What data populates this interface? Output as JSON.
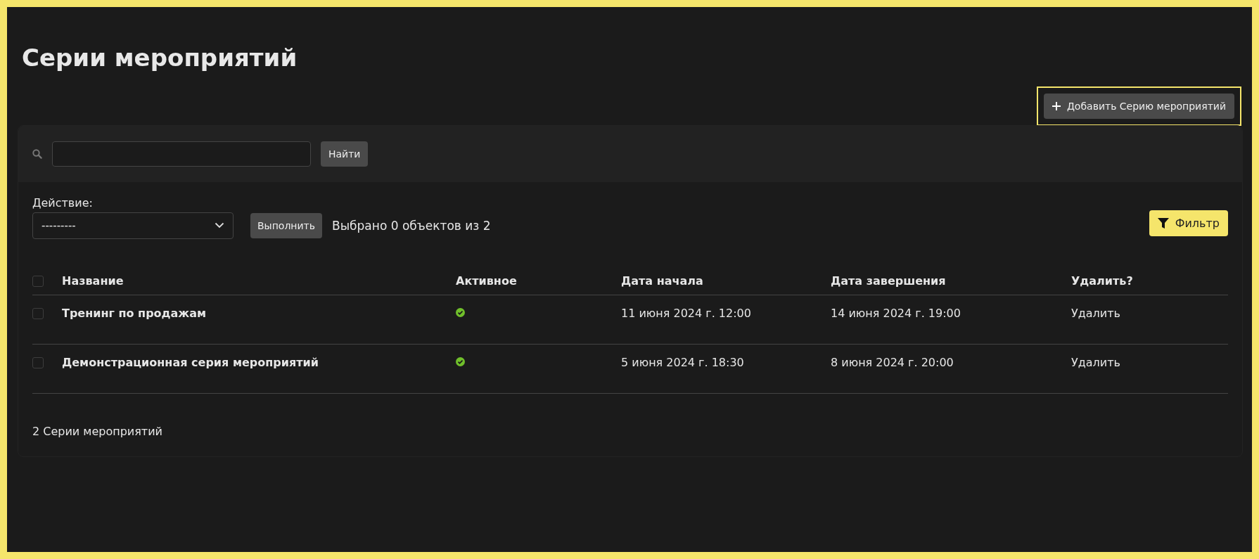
{
  "page": {
    "title": "Серии мероприятий",
    "add_button": "Добавить Серию мероприятий"
  },
  "search": {
    "button": "Найти"
  },
  "actions": {
    "label": "Действие:",
    "select_value": "---------",
    "run_button": "Выполнить",
    "selection_count": "Выбрано 0 объектов из 2",
    "filter_button": "Фильтр"
  },
  "table": {
    "select_all_checked": false,
    "columns": [
      "Название",
      "Активное",
      "Дата начала",
      "Дата завершения",
      "Удалить?"
    ],
    "rows": [
      {
        "checked": false,
        "name": "Тренинг по продажам",
        "active": true,
        "start": "11 июня 2024 г. 12:00",
        "end": "14 июня 2024 г. 19:00",
        "delete": "Удалить"
      },
      {
        "checked": false,
        "name": "Демонстрационная серия мероприятий",
        "active": true,
        "start": "5 июня 2024 г. 18:30",
        "end": "8 июня 2024 г. 20:00",
        "delete": "Удалить"
      }
    ]
  },
  "footer": {
    "count": "2 Серии мероприятий"
  }
}
